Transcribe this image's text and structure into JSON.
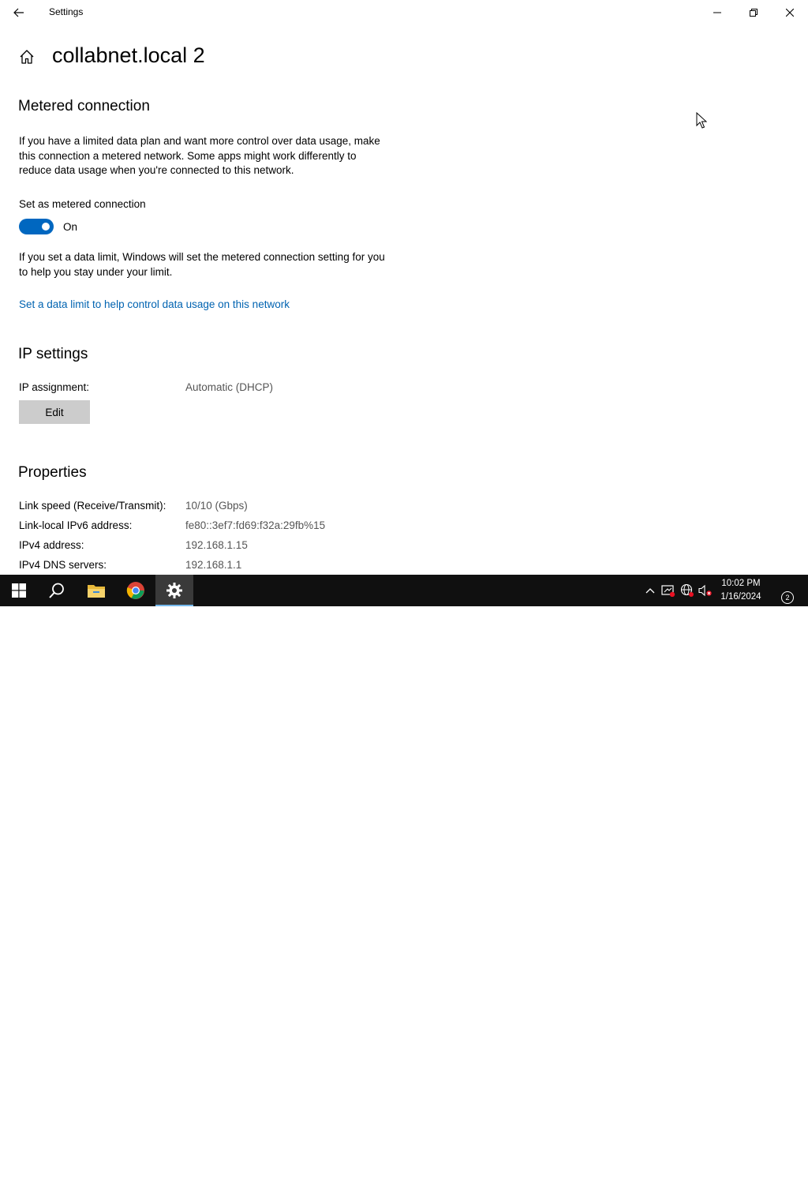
{
  "window": {
    "title": "Settings"
  },
  "header": {
    "page_title": "collabnet.local 2"
  },
  "metered": {
    "section_title": "Metered connection",
    "description": "If you have a limited data plan and want more control over data usage, make this connection a metered network. Some apps might work differently to reduce data usage when you're connected to this network.",
    "toggle_label": "Set as metered connection",
    "toggle_state": "On",
    "toggle_on": true,
    "limit_note": "If you set a data limit, Windows will set the metered connection setting for you to help you stay under your limit.",
    "data_limit_link": "Set a data limit to help control data usage on this network"
  },
  "ip_settings": {
    "section_title": "IP settings",
    "assignment_label": "IP assignment:",
    "assignment_value": "Automatic (DHCP)",
    "edit_label": "Edit"
  },
  "properties": {
    "section_title": "Properties",
    "rows": [
      {
        "label": "Link speed (Receive/Transmit):",
        "value": "10/10 (Gbps)"
      },
      {
        "label": "Link-local IPv6 address:",
        "value": "fe80::3ef7:fd69:f32a:29fb%15"
      },
      {
        "label": "IPv4 address:",
        "value": "192.168.1.15"
      },
      {
        "label": "IPv4 DNS servers:",
        "value": "192.168.1.1"
      }
    ]
  },
  "taskbar": {
    "time": "10:02 PM",
    "date": "1/16/2024",
    "notification_count": "2",
    "pinned": [
      "start-icon",
      "search-icon",
      "file-explorer-icon",
      "chrome-icon",
      "settings-icon"
    ],
    "active_app": "settings"
  },
  "colors": {
    "accent": "#0067c0",
    "link": "#0063b1",
    "taskbar_bg": "#101010",
    "button_bg": "#cccccc"
  }
}
